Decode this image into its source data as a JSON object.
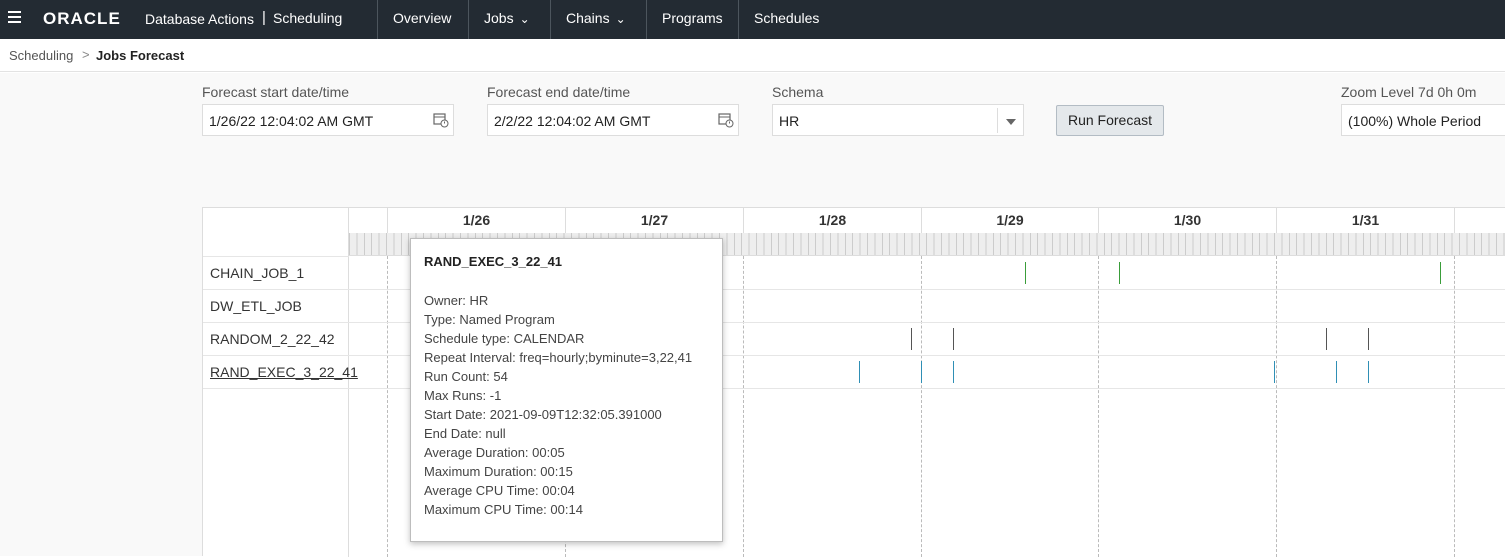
{
  "topbar": {
    "logo": "ORACLE",
    "app_name": "Database Actions",
    "separator": "|",
    "section": "Scheduling",
    "nav": [
      {
        "label": "Overview",
        "dropdown": false
      },
      {
        "label": "Jobs",
        "dropdown": true
      },
      {
        "label": "Chains",
        "dropdown": true
      },
      {
        "label": "Programs",
        "dropdown": false
      },
      {
        "label": "Schedules",
        "dropdown": false
      }
    ]
  },
  "breadcrumb": {
    "root": "Scheduling",
    "separator": ">",
    "current": "Jobs Forecast"
  },
  "form": {
    "start": {
      "label": "Forecast start date/time",
      "value": "1/26/22 12:04:02 AM GMT"
    },
    "end": {
      "label": "Forecast end date/time",
      "value": "2/2/22 12:04:02 AM GMT"
    },
    "schema": {
      "label": "Schema",
      "value": "HR"
    },
    "run_label": "Run Forecast",
    "zoom": {
      "label": "Zoom Level 7d 0h 0m",
      "value": "(100%) Whole Period"
    }
  },
  "gantt": {
    "days": [
      "1/26",
      "1/27",
      "1/28",
      "1/29",
      "1/30",
      "1/31"
    ],
    "jobs": [
      {
        "name": "CHAIN_JOB_1",
        "link": false
      },
      {
        "name": "DW_ETL_JOB",
        "link": false
      },
      {
        "name": "RANDOM_2_22_42",
        "link": false
      },
      {
        "name": "RAND_EXEC_3_22_41",
        "link": true
      }
    ],
    "colors": {
      "chain": "#3a9d3a",
      "random": "#555555",
      "rand_exec": "#2f8fb5"
    }
  },
  "tooltip": {
    "title": "RAND_EXEC_3_22_41",
    "owner": "Owner: HR",
    "type": "Type: Named Program",
    "schedule_type": "Schedule type: CALENDAR",
    "repeat_interval": "Repeat Interval: freq=hourly;byminute=3,22,41",
    "run_count": "Run Count: 54",
    "max_runs": "Max Runs: -1",
    "start_date": "Start Date: 2021-09-09T12:32:05.391000",
    "end_date": "End Date: null",
    "avg_duration": "Average Duration: 00:05",
    "max_duration": "Maximum Duration: 00:15",
    "avg_cpu": "Average CPU Time: 00:04",
    "max_cpu": "Maximum CPU Time: 00:14"
  }
}
